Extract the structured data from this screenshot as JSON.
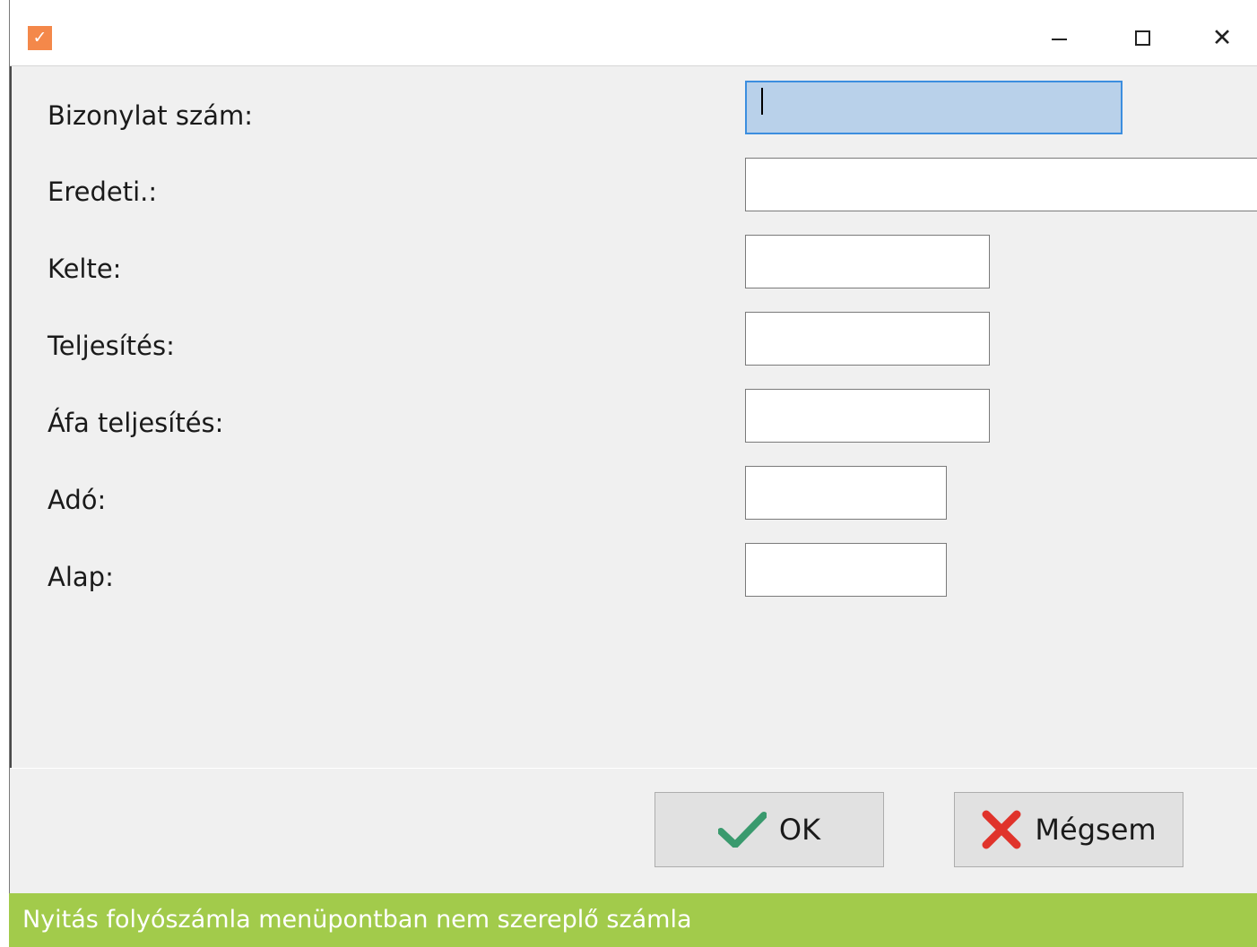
{
  "window": {
    "app_icon": "checkmark-icon",
    "app_icon_glyph": "✓",
    "app_icon_color": "#f4884a",
    "controls": {
      "minimize": "minimize-icon",
      "maximize": "maximize-icon",
      "close": "close-icon",
      "close_glyph": "✕"
    }
  },
  "form": {
    "fields": [
      {
        "label": "Bizonylat szám:",
        "value": ""
      },
      {
        "label": "Eredeti.:",
        "value": ""
      },
      {
        "label": "Kelte:",
        "value": ""
      },
      {
        "label": "Teljesítés:",
        "value": ""
      },
      {
        "label": "Áfa teljesítés:",
        "value": ""
      },
      {
        "label": "Adó:",
        "value": ""
      },
      {
        "label": "Alap:",
        "value": ""
      }
    ],
    "focused_field_color": "#b9d1ea"
  },
  "buttons": {
    "ok": {
      "label": "OK",
      "icon": "checkmark-icon",
      "icon_color": "#3a9a6e"
    },
    "cancel": {
      "label": "Mégsem",
      "icon": "close-x-icon",
      "icon_color": "#e0332b"
    }
  },
  "caption": {
    "text": "Nyitás folyószámla menüpontban nem szereplő számla",
    "background": "#a2cb4b"
  }
}
